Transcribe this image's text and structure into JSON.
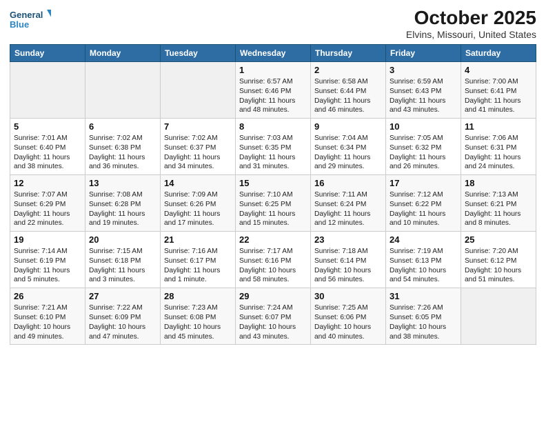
{
  "logo": {
    "line1": "General",
    "line2": "Blue"
  },
  "title": "October 2025",
  "location": "Elvins, Missouri, United States",
  "days_of_week": [
    "Sunday",
    "Monday",
    "Tuesday",
    "Wednesday",
    "Thursday",
    "Friday",
    "Saturday"
  ],
  "weeks": [
    [
      {
        "day": "",
        "empty": true
      },
      {
        "day": "",
        "empty": true
      },
      {
        "day": "",
        "empty": true
      },
      {
        "day": "1",
        "sunrise": "6:57 AM",
        "sunset": "6:46 PM",
        "daylight": "11 hours and 48 minutes."
      },
      {
        "day": "2",
        "sunrise": "6:58 AM",
        "sunset": "6:44 PM",
        "daylight": "11 hours and 46 minutes."
      },
      {
        "day": "3",
        "sunrise": "6:59 AM",
        "sunset": "6:43 PM",
        "daylight": "11 hours and 43 minutes."
      },
      {
        "day": "4",
        "sunrise": "7:00 AM",
        "sunset": "6:41 PM",
        "daylight": "11 hours and 41 minutes."
      }
    ],
    [
      {
        "day": "5",
        "sunrise": "7:01 AM",
        "sunset": "6:40 PM",
        "daylight": "11 hours and 38 minutes."
      },
      {
        "day": "6",
        "sunrise": "7:02 AM",
        "sunset": "6:38 PM",
        "daylight": "11 hours and 36 minutes."
      },
      {
        "day": "7",
        "sunrise": "7:02 AM",
        "sunset": "6:37 PM",
        "daylight": "11 hours and 34 minutes."
      },
      {
        "day": "8",
        "sunrise": "7:03 AM",
        "sunset": "6:35 PM",
        "daylight": "11 hours and 31 minutes."
      },
      {
        "day": "9",
        "sunrise": "7:04 AM",
        "sunset": "6:34 PM",
        "daylight": "11 hours and 29 minutes."
      },
      {
        "day": "10",
        "sunrise": "7:05 AM",
        "sunset": "6:32 PM",
        "daylight": "11 hours and 26 minutes."
      },
      {
        "day": "11",
        "sunrise": "7:06 AM",
        "sunset": "6:31 PM",
        "daylight": "11 hours and 24 minutes."
      }
    ],
    [
      {
        "day": "12",
        "sunrise": "7:07 AM",
        "sunset": "6:29 PM",
        "daylight": "11 hours and 22 minutes."
      },
      {
        "day": "13",
        "sunrise": "7:08 AM",
        "sunset": "6:28 PM",
        "daylight": "11 hours and 19 minutes."
      },
      {
        "day": "14",
        "sunrise": "7:09 AM",
        "sunset": "6:26 PM",
        "daylight": "11 hours and 17 minutes."
      },
      {
        "day": "15",
        "sunrise": "7:10 AM",
        "sunset": "6:25 PM",
        "daylight": "11 hours and 15 minutes."
      },
      {
        "day": "16",
        "sunrise": "7:11 AM",
        "sunset": "6:24 PM",
        "daylight": "11 hours and 12 minutes."
      },
      {
        "day": "17",
        "sunrise": "7:12 AM",
        "sunset": "6:22 PM",
        "daylight": "11 hours and 10 minutes."
      },
      {
        "day": "18",
        "sunrise": "7:13 AM",
        "sunset": "6:21 PM",
        "daylight": "11 hours and 8 minutes."
      }
    ],
    [
      {
        "day": "19",
        "sunrise": "7:14 AM",
        "sunset": "6:19 PM",
        "daylight": "11 hours and 5 minutes."
      },
      {
        "day": "20",
        "sunrise": "7:15 AM",
        "sunset": "6:18 PM",
        "daylight": "11 hours and 3 minutes."
      },
      {
        "day": "21",
        "sunrise": "7:16 AM",
        "sunset": "6:17 PM",
        "daylight": "11 hours and 1 minute."
      },
      {
        "day": "22",
        "sunrise": "7:17 AM",
        "sunset": "6:16 PM",
        "daylight": "10 hours and 58 minutes."
      },
      {
        "day": "23",
        "sunrise": "7:18 AM",
        "sunset": "6:14 PM",
        "daylight": "10 hours and 56 minutes."
      },
      {
        "day": "24",
        "sunrise": "7:19 AM",
        "sunset": "6:13 PM",
        "daylight": "10 hours and 54 minutes."
      },
      {
        "day": "25",
        "sunrise": "7:20 AM",
        "sunset": "6:12 PM",
        "daylight": "10 hours and 51 minutes."
      }
    ],
    [
      {
        "day": "26",
        "sunrise": "7:21 AM",
        "sunset": "6:10 PM",
        "daylight": "10 hours and 49 minutes."
      },
      {
        "day": "27",
        "sunrise": "7:22 AM",
        "sunset": "6:09 PM",
        "daylight": "10 hours and 47 minutes."
      },
      {
        "day": "28",
        "sunrise": "7:23 AM",
        "sunset": "6:08 PM",
        "daylight": "10 hours and 45 minutes."
      },
      {
        "day": "29",
        "sunrise": "7:24 AM",
        "sunset": "6:07 PM",
        "daylight": "10 hours and 43 minutes."
      },
      {
        "day": "30",
        "sunrise": "7:25 AM",
        "sunset": "6:06 PM",
        "daylight": "10 hours and 40 minutes."
      },
      {
        "day": "31",
        "sunrise": "7:26 AM",
        "sunset": "6:05 PM",
        "daylight": "10 hours and 38 minutes."
      },
      {
        "day": "",
        "empty": true
      }
    ]
  ]
}
